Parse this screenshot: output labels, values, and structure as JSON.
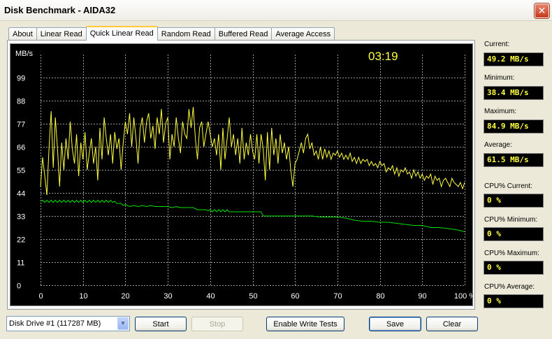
{
  "window": {
    "title": "Disk Benchmark - AIDA32",
    "close_glyph": "✕"
  },
  "tabs": [
    {
      "label": "About",
      "active": false
    },
    {
      "label": "Linear Read",
      "active": false
    },
    {
      "label": "Quick Linear Read",
      "active": true
    },
    {
      "label": "Random Read",
      "active": false
    },
    {
      "label": "Buffered Read",
      "active": false
    },
    {
      "label": "Average Access",
      "active": false
    }
  ],
  "stats": {
    "current_label": "Current:",
    "current_value": "49.2 MB/s",
    "minimum_label": "Minimum:",
    "minimum_value": "38.4 MB/s",
    "maximum_label": "Maximum:",
    "maximum_value": "84.9 MB/s",
    "average_label": "Average:",
    "average_value": "61.5 MB/s",
    "cpu_current_label": "CPU% Current:",
    "cpu_current_value": "0 %",
    "cpu_minimum_label": "CPU% Minimum:",
    "cpu_minimum_value": "0 %",
    "cpu_maximum_label": "CPU% Maximum:",
    "cpu_maximum_value": "0 %",
    "cpu_average_label": "CPU% Average:",
    "cpu_average_value": "0 %"
  },
  "controls": {
    "drive_select": "Disk Drive #1  (117287 MB)",
    "start": "Start",
    "stop": "Stop",
    "enable_write": "Enable Write Tests",
    "save": "Save",
    "clear": "Clear"
  },
  "chart_data": {
    "type": "line",
    "timer": "03:19",
    "y_unit": "MB/s",
    "y_ticks": [
      "99",
      "88",
      "77",
      "66",
      "55",
      "44",
      "33",
      "22",
      "11",
      "0"
    ],
    "x_ticks": [
      "0",
      "10",
      "20",
      "30",
      "40",
      "50",
      "60",
      "70",
      "80",
      "90",
      "100 %"
    ],
    "ylim": [
      0,
      110
    ],
    "xlim": [
      0,
      100
    ],
    "grid": true,
    "colors": {
      "read": "#ffff40",
      "cpu": "#00e000",
      "grid": "#9a9a9a",
      "text": "#ffffff",
      "timer": "#ffff40"
    },
    "series": [
      {
        "values": [
          [
            0,
            47
          ],
          [
            0.5,
            61
          ],
          [
            1,
            52
          ],
          [
            1.5,
            43
          ],
          [
            2,
            65
          ],
          [
            2.5,
            83
          ],
          [
            3,
            56
          ],
          [
            3.5,
            80
          ],
          [
            4,
            65
          ],
          [
            4.5,
            47
          ],
          [
            5,
            68
          ],
          [
            5.5,
            55
          ],
          [
            6,
            70
          ],
          [
            6.5,
            60
          ],
          [
            7,
            78
          ],
          [
            7.5,
            65
          ],
          [
            8,
            58
          ],
          [
            8.5,
            72
          ],
          [
            9,
            52
          ],
          [
            9.5,
            68
          ],
          [
            10,
            60
          ],
          [
            10.5,
            73
          ],
          [
            11,
            55
          ],
          [
            11.5,
            63
          ],
          [
            12,
            70
          ],
          [
            12.5,
            58
          ],
          [
            13,
            66
          ],
          [
            13.5,
            50
          ],
          [
            14,
            75
          ],
          [
            14.5,
            60
          ],
          [
            15,
            80
          ],
          [
            15.5,
            70
          ],
          [
            16,
            62
          ],
          [
            16.5,
            72
          ],
          [
            17,
            58
          ],
          [
            17.5,
            73
          ],
          [
            18,
            65
          ],
          [
            18.5,
            70
          ],
          [
            19,
            55
          ],
          [
            19.5,
            68
          ],
          [
            20,
            78
          ],
          [
            20.5,
            72
          ],
          [
            21,
            82
          ],
          [
            21.5,
            66
          ],
          [
            22,
            80
          ],
          [
            22.5,
            70
          ],
          [
            23,
            58
          ],
          [
            23.5,
            75
          ],
          [
            24,
            80
          ],
          [
            24.5,
            68
          ],
          [
            25,
            78
          ],
          [
            25.5,
            82
          ],
          [
            26,
            70
          ],
          [
            26.5,
            76
          ],
          [
            27,
            65
          ],
          [
            27.5,
            80
          ],
          [
            28,
            72
          ],
          [
            28.5,
            84
          ],
          [
            29,
            68
          ],
          [
            29.5,
            77
          ],
          [
            30,
            80
          ],
          [
            30.5,
            60
          ],
          [
            31,
            72
          ],
          [
            31.5,
            66
          ],
          [
            32,
            80
          ],
          [
            32.5,
            70
          ],
          [
            33,
            63
          ],
          [
            33.5,
            78
          ],
          [
            34,
            72
          ],
          [
            34.5,
            70
          ],
          [
            35,
            84
          ],
          [
            35.5,
            75
          ],
          [
            36,
            85
          ],
          [
            36.5,
            70
          ],
          [
            37,
            60
          ],
          [
            37.5,
            75
          ],
          [
            38,
            78
          ],
          [
            38.5,
            66
          ],
          [
            39,
            72
          ],
          [
            39.5,
            78
          ],
          [
            40,
            72
          ],
          [
            40.5,
            66
          ],
          [
            41,
            70
          ],
          [
            41.5,
            62
          ],
          [
            42,
            72
          ],
          [
            42.5,
            55
          ],
          [
            43,
            75
          ],
          [
            43.5,
            60
          ],
          [
            44,
            70
          ],
          [
            44.5,
            80
          ],
          [
            45,
            66
          ],
          [
            45.5,
            72
          ],
          [
            46,
            62
          ],
          [
            46.5,
            70
          ],
          [
            47,
            58
          ],
          [
            47.5,
            75
          ],
          [
            48,
            60
          ],
          [
            48.5,
            68
          ],
          [
            49,
            62
          ],
          [
            49.5,
            72
          ],
          [
            50,
            64
          ],
          [
            50.5,
            60
          ],
          [
            51,
            72
          ],
          [
            51.5,
            58
          ],
          [
            52,
            72
          ],
          [
            52.5,
            65
          ],
          [
            53,
            50
          ],
          [
            53.5,
            73
          ],
          [
            54,
            55
          ],
          [
            54.5,
            75
          ],
          [
            55,
            62
          ],
          [
            55.5,
            70
          ],
          [
            56,
            58
          ],
          [
            56.5,
            72
          ],
          [
            57,
            63
          ],
          [
            57.5,
            68
          ],
          [
            58,
            60
          ],
          [
            58.5,
            66
          ],
          [
            59,
            55
          ],
          [
            59.5,
            47
          ],
          [
            60,
            58
          ],
          [
            60.5,
            60
          ],
          [
            61,
            64
          ],
          [
            61.5,
            68
          ],
          [
            62,
            63
          ],
          [
            62.5,
            70
          ],
          [
            63,
            72
          ],
          [
            63.5,
            65
          ],
          [
            64,
            68
          ],
          [
            64.5,
            62
          ],
          [
            65,
            64
          ],
          [
            65.5,
            60
          ],
          [
            66,
            66
          ],
          [
            66.5,
            60
          ],
          [
            67,
            65
          ],
          [
            67.5,
            61
          ],
          [
            68,
            64
          ],
          [
            68.5,
            60
          ],
          [
            69,
            63
          ],
          [
            69.5,
            62
          ],
          [
            70,
            64
          ],
          [
            70.5,
            61
          ],
          [
            71,
            63
          ],
          [
            71.5,
            60
          ],
          [
            72,
            62
          ],
          [
            72.5,
            60
          ],
          [
            73,
            63
          ],
          [
            73.5,
            59
          ],
          [
            74,
            61
          ],
          [
            74.5,
            58
          ],
          [
            75,
            61
          ],
          [
            75.5,
            58
          ],
          [
            76,
            60
          ],
          [
            76.5,
            59
          ],
          [
            77,
            60
          ],
          [
            77.5,
            57
          ],
          [
            78,
            59
          ],
          [
            78.5,
            57
          ],
          [
            79,
            58
          ],
          [
            79.5,
            56
          ],
          [
            80,
            59
          ],
          [
            80.5,
            57
          ],
          [
            81,
            58
          ],
          [
            81.5,
            54
          ],
          [
            82,
            56
          ],
          [
            82.5,
            55
          ],
          [
            83,
            57
          ],
          [
            83.5,
            53
          ],
          [
            84,
            56
          ],
          [
            84.5,
            52
          ],
          [
            85,
            55
          ],
          [
            85.5,
            54
          ],
          [
            86,
            56
          ],
          [
            86.5,
            53
          ],
          [
            87,
            54
          ],
          [
            87.5,
            51
          ],
          [
            88,
            55
          ],
          [
            88.5,
            52
          ],
          [
            89,
            54
          ],
          [
            89.5,
            51
          ],
          [
            90,
            53
          ],
          [
            90.5,
            50
          ],
          [
            91,
            52
          ],
          [
            91.5,
            51
          ],
          [
            92,
            53
          ],
          [
            92.5,
            48
          ],
          [
            93,
            52
          ],
          [
            93.5,
            50
          ],
          [
            94,
            51
          ],
          [
            94.5,
            47
          ],
          [
            95,
            50
          ],
          [
            95.5,
            51
          ],
          [
            96,
            49
          ],
          [
            96.5,
            47
          ],
          [
            97,
            51
          ],
          [
            97.5,
            49
          ],
          [
            98,
            48
          ],
          [
            98.5,
            47
          ],
          [
            99,
            49
          ],
          [
            99.5,
            46
          ],
          [
            100,
            49
          ]
        ]
      },
      {
        "values": [
          [
            0,
            40
          ],
          [
            0.5,
            40.5
          ],
          [
            1,
            39.5
          ],
          [
            1.5,
            40.5
          ],
          [
            2,
            39.5
          ],
          [
            2.5,
            40.5
          ],
          [
            3,
            39.5
          ],
          [
            3.5,
            40.5
          ],
          [
            4,
            39.5
          ],
          [
            4.5,
            40.5
          ],
          [
            5,
            39.5
          ],
          [
            5.5,
            40.5
          ],
          [
            6,
            39.5
          ],
          [
            6.5,
            40.5
          ],
          [
            7,
            39.5
          ],
          [
            7.5,
            40.5
          ],
          [
            8,
            39.5
          ],
          [
            8.5,
            40.5
          ],
          [
            9,
            39.5
          ],
          [
            9.5,
            40.5
          ],
          [
            10,
            39.5
          ],
          [
            10.5,
            40.5
          ],
          [
            11,
            39.5
          ],
          [
            11.5,
            40.5
          ],
          [
            12,
            39.5
          ],
          [
            12.5,
            40.5
          ],
          [
            13,
            39.5
          ],
          [
            13.5,
            40.5
          ],
          [
            14,
            39.5
          ],
          [
            14.5,
            40.5
          ],
          [
            15,
            39.5
          ],
          [
            15.5,
            40.5
          ],
          [
            16,
            39.5
          ],
          [
            16.5,
            40.5
          ],
          [
            17,
            39.5
          ],
          [
            17.5,
            40
          ],
          [
            18,
            39
          ],
          [
            19,
            39
          ],
          [
            19.5,
            38
          ],
          [
            20,
            38.5
          ],
          [
            21,
            37.5
          ],
          [
            22,
            38
          ],
          [
            23,
            37.5
          ],
          [
            24,
            38
          ],
          [
            25,
            37.5
          ],
          [
            26,
            38
          ],
          [
            27,
            37.5
          ],
          [
            28,
            37.5
          ],
          [
            29,
            37.5
          ],
          [
            30,
            37.5
          ],
          [
            31,
            37
          ],
          [
            32,
            37.5
          ],
          [
            33,
            37
          ],
          [
            34,
            37
          ],
          [
            35,
            37
          ],
          [
            36,
            37
          ],
          [
            37,
            36
          ],
          [
            38,
            36
          ],
          [
            39,
            36
          ],
          [
            39.5,
            35.5
          ],
          [
            40,
            36
          ],
          [
            40.5,
            35
          ],
          [
            41,
            36
          ],
          [
            41.5,
            35
          ],
          [
            42,
            36
          ],
          [
            42.5,
            35
          ],
          [
            43,
            36
          ],
          [
            43.5,
            35
          ],
          [
            44,
            36
          ],
          [
            44.5,
            35
          ],
          [
            45,
            35
          ],
          [
            46,
            35
          ],
          [
            47,
            35
          ],
          [
            48,
            35
          ],
          [
            49,
            35
          ],
          [
            50,
            35
          ],
          [
            51,
            35
          ],
          [
            52,
            35
          ],
          [
            52.5,
            33
          ],
          [
            54,
            33
          ],
          [
            56,
            33
          ],
          [
            58,
            33
          ],
          [
            60,
            33
          ],
          [
            62,
            33
          ],
          [
            64,
            33
          ],
          [
            66,
            32.5
          ],
          [
            68,
            32.5
          ],
          [
            70,
            32.5
          ],
          [
            72,
            32
          ],
          [
            74,
            31
          ],
          [
            76,
            30.5
          ],
          [
            78,
            30.5
          ],
          [
            80,
            30
          ],
          [
            82,
            30
          ],
          [
            84,
            29.5
          ],
          [
            86,
            29
          ],
          [
            88,
            28.5
          ],
          [
            90,
            28.5
          ],
          [
            92,
            27.5
          ],
          [
            94,
            27.5
          ],
          [
            96,
            27
          ],
          [
            98,
            26.5
          ],
          [
            99,
            26
          ],
          [
            100,
            25.5
          ]
        ]
      }
    ]
  }
}
